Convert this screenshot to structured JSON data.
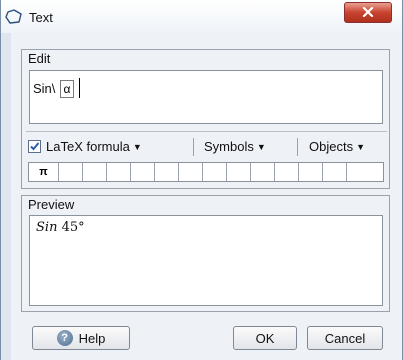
{
  "window": {
    "title": "Text",
    "title_icon": "polygon-outline-icon",
    "close_icon": "close-x-icon"
  },
  "edit": {
    "label": "Edit",
    "text_prefix": "Sin\\",
    "box_symbol": "α"
  },
  "toolbar": {
    "latex_checked": true,
    "latex_label": "LaTeX formula",
    "symbols_label": "Symbols",
    "objects_label": "Objects"
  },
  "symbols": {
    "cells": [
      "π",
      "",
      "",
      "",
      "",
      "",
      "",
      "",
      "",
      "",
      "",
      "",
      "",
      ""
    ]
  },
  "preview": {
    "label": "Preview",
    "fn": "Sin",
    "value": "45°"
  },
  "buttons": {
    "help": "Help",
    "ok": "OK",
    "cancel": "Cancel"
  }
}
